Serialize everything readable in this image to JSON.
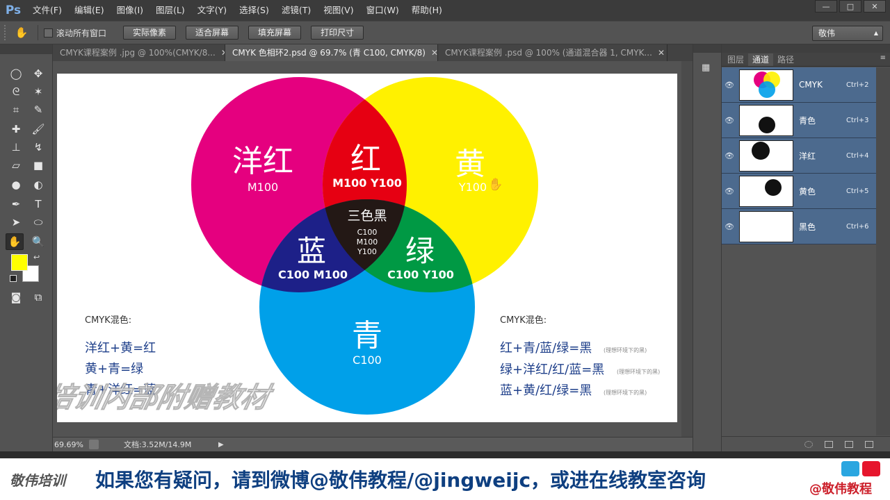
{
  "app": {
    "logo": "Ps"
  },
  "menu": [
    "文件(F)",
    "编辑(E)",
    "图像(I)",
    "图层(L)",
    "文字(Y)",
    "选择(S)",
    "滤镜(T)",
    "视图(V)",
    "窗口(W)",
    "帮助(H)"
  ],
  "window_buttons": {
    "minimize": "—",
    "maximize": "□",
    "close": "✕"
  },
  "options": {
    "scroll_all_label": "滚动所有窗口",
    "btn_actual": "实际像素",
    "btn_fit": "适合屏幕",
    "btn_fill": "填充屏幕",
    "btn_print": "打印尺寸",
    "workspace": "敬伟"
  },
  "tabs": [
    {
      "label": "CMYK课程案例 .jpg @ 100%(CMYK/8...",
      "active": false
    },
    {
      "label": "CMYK 色相环2.psd @ 69.7% (青   C100, CMYK/8)",
      "active": true
    },
    {
      "label": "CMYK课程案例 .psd @ 100% (通道混合器 1, CMYK...",
      "active": false
    }
  ],
  "tab_close": "✕",
  "artwork": {
    "magenta_title": "洋红",
    "magenta_sub": "M100",
    "red_title": "红",
    "red_sub": "M100 Y100",
    "yellow_title": "黄",
    "yellow_sub": "Y100",
    "black_title": "三色黑",
    "black_c": "C100",
    "black_m": "M100",
    "black_y": "Y100",
    "blue_title": "蓝",
    "blue_sub": "C100 M100",
    "green_title": "绿",
    "green_sub": "C100 Y100",
    "cyan_title": "青",
    "cyan_sub": "C100",
    "left_heading": "CMYK混色:",
    "left_lines": [
      "洋红+黄=红",
      "黄+青=绿",
      "青+洋红=蓝"
    ],
    "right_heading": "CMYK混色:",
    "right_lines": [
      {
        "main": "红+青/蓝/绿=黑",
        "note": "(理想环境下的黑)"
      },
      {
        "main": "绿+洋红/红/蓝=黑",
        "note": "(理想环境下的黑)"
      },
      {
        "main": "蓝+黄/红/绿=黑",
        "note": "(理想环境下的黑)"
      }
    ],
    "watermark": "敬伟培训内部附赠教材"
  },
  "status": {
    "zoom": "69.69%",
    "doc": "文档:3.52M/14.9M"
  },
  "panel": {
    "tabs": [
      "图层",
      "通道",
      "路径"
    ],
    "active_tab": "通道",
    "channels": [
      {
        "name": "CMYK",
        "key": "Ctrl+2"
      },
      {
        "name": "青色",
        "key": "Ctrl+3"
      },
      {
        "name": "洋红",
        "key": "Ctrl+4"
      },
      {
        "name": "黄色",
        "key": "Ctrl+5"
      },
      {
        "name": "黑色",
        "key": "Ctrl+6"
      }
    ]
  },
  "banner": {
    "logo": "敬伟培训",
    "message": "如果您有疑问，请到微博@敬伟教程/@jingweijc，或进在线教室咨询",
    "handle": "@敬伟教程"
  },
  "colors": {
    "magenta": "#e5007f",
    "yellow": "#fff100",
    "cyan": "#00a0e9",
    "red": "#e60012",
    "green": "#009944",
    "blue": "#1d2088",
    "black": "#231815",
    "text_blue": "#1e3f8a",
    "fg_swatch": "#ffff00",
    "channel_row": "#4c6a8e"
  },
  "icons": [
    "marquee-icon",
    "move-icon",
    "lasso-icon",
    "magic-wand-icon",
    "crop-icon",
    "eyedropper-icon",
    "healing-icon",
    "brush-icon",
    "stamp-icon",
    "history-brush-icon",
    "eraser-icon",
    "gradient-icon",
    "blur-icon",
    "dodge-icon",
    "pen-icon",
    "type-icon",
    "path-select-icon",
    "ellipse-icon",
    "hand-icon",
    "zoom-icon",
    "quickmask-icon",
    "screenmode-icon",
    "eye-icon"
  ]
}
